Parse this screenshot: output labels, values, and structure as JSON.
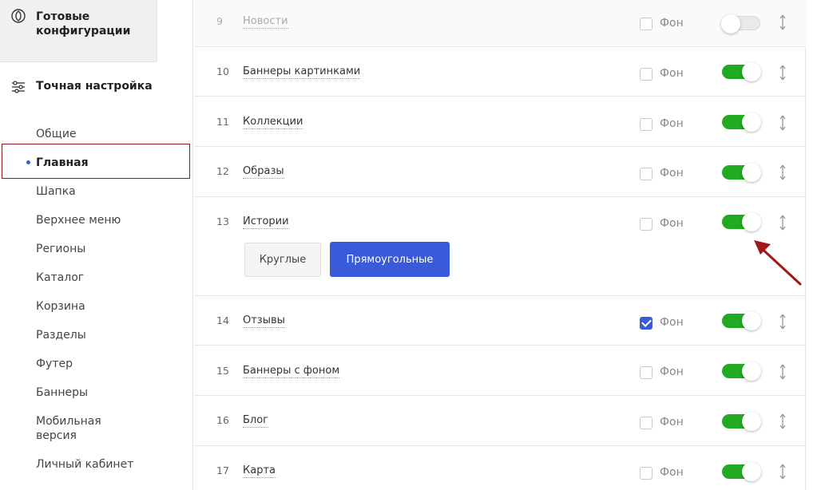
{
  "sidebar": {
    "ready_title": "Готовые конфигурации",
    "fine_title": "Точная настройка",
    "items": [
      {
        "label": "Общие"
      },
      {
        "label": "Главная",
        "active": true
      },
      {
        "label": "Шапка"
      },
      {
        "label": "Верхнее меню"
      },
      {
        "label": "Регионы"
      },
      {
        "label": "Каталог"
      },
      {
        "label": "Корзина"
      },
      {
        "label": "Разделы"
      },
      {
        "label": "Футер"
      },
      {
        "label": "Баннеры"
      },
      {
        "label": "Мобильная версия"
      },
      {
        "label": "Личный кабинет"
      }
    ]
  },
  "rows": [
    {
      "num": "9",
      "name": "Новости",
      "fon": "Фон",
      "bg_checked": false,
      "enabled": false
    },
    {
      "num": "10",
      "name": "Баннеры картинками",
      "fon": "Фон",
      "bg_checked": false,
      "enabled": true
    },
    {
      "num": "11",
      "name": "Коллекции",
      "fon": "Фон",
      "bg_checked": false,
      "enabled": true
    },
    {
      "num": "12",
      "name": "Образы",
      "fon": "Фон",
      "bg_checked": false,
      "enabled": true
    },
    {
      "num": "13",
      "name": "Истории",
      "fon": "Фон",
      "bg_checked": false,
      "enabled": true
    },
    {
      "num": "14",
      "name": "Отзывы",
      "fon": "Фон",
      "bg_checked": true,
      "enabled": true
    },
    {
      "num": "15",
      "name": "Баннеры с фоном",
      "fon": "Фон",
      "bg_checked": false,
      "enabled": true
    },
    {
      "num": "16",
      "name": "Блог",
      "fon": "Фон",
      "bg_checked": false,
      "enabled": true
    },
    {
      "num": "17",
      "name": "Карта",
      "fon": "Фон",
      "bg_checked": false,
      "enabled": true
    }
  ],
  "stories_options": {
    "round_label": "Круглые",
    "rect_label": "Прямоугольные",
    "selected": "Прямоугольные"
  },
  "colors": {
    "accent": "#3a5bd9",
    "toggle_on": "#22aa22",
    "highlight": "#8b1a1a"
  }
}
